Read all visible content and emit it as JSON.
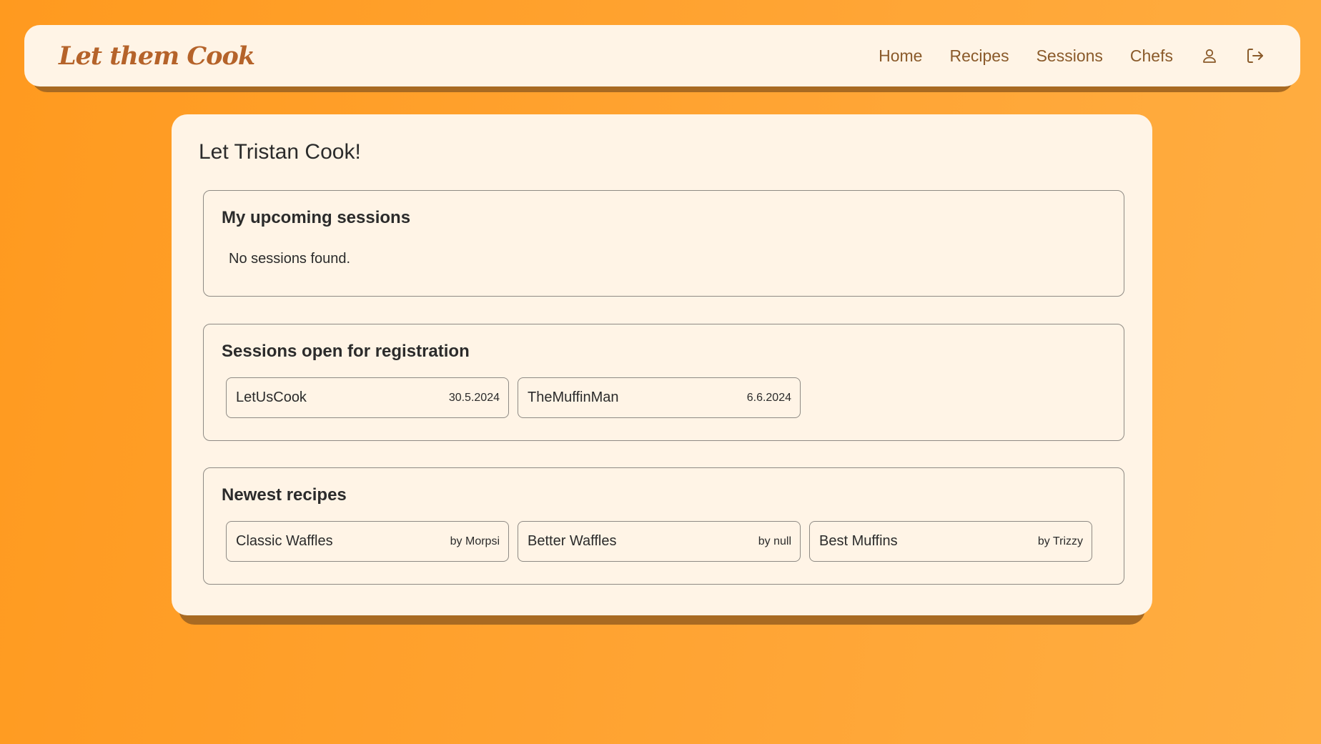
{
  "navbar": {
    "brand": "Let them Cook",
    "links": {
      "home": "Home",
      "recipes": "Recipes",
      "sessions": "Sessions",
      "chefs": "Chefs"
    },
    "icons": [
      "user-icon",
      "logout-icon"
    ]
  },
  "main": {
    "title": "Let Tristan Cook!",
    "upcoming": {
      "title": "My upcoming sessions",
      "empty_text": "No sessions found."
    },
    "open_sessions": {
      "title": "Sessions open for registration",
      "items": [
        {
          "name": "LetUsCook",
          "date": "30.5.2024"
        },
        {
          "name": "TheMuffinMan",
          "date": "6.6.2024"
        }
      ]
    },
    "newest_recipes": {
      "title": "Newest recipes",
      "items": [
        {
          "name": "Classic Waffles",
          "author": "by Morpsi"
        },
        {
          "name": "Better Waffles",
          "author": "by null"
        },
        {
          "name": "Best Muffins",
          "author": "by Trizzy"
        }
      ]
    }
  },
  "colors": {
    "background": "#ff9a1f",
    "surface": "#fff4e6",
    "brand": "#b5632a",
    "nav_text": "#8a5a2a",
    "shadow": "#a86a22"
  }
}
